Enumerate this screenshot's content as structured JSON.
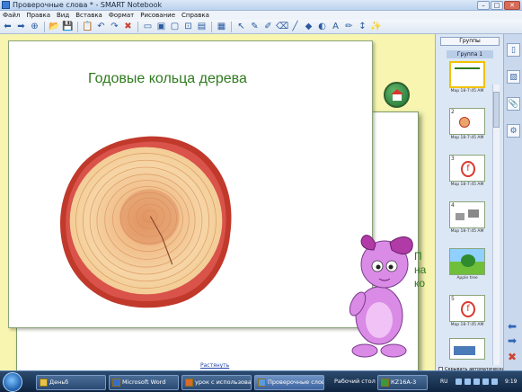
{
  "window": {
    "title": "Проверочные слова * - SMART Notebook",
    "buttons": [
      "–",
      "□",
      "✕"
    ]
  },
  "menu": [
    "Файл",
    "Правка",
    "Вид",
    "Вставка",
    "Формат",
    "Рисование",
    "Справка"
  ],
  "toolbar": {
    "icons": [
      "back-icon",
      "forward-icon",
      "add-page-icon",
      "sep",
      "open-icon",
      "save-icon",
      "sep",
      "paste-icon",
      "undo-icon",
      "redo-icon",
      "delete-icon",
      "sep",
      "screen-shade-icon",
      "display-icon",
      "fullscreen-icon",
      "capture-icon",
      "record-icon",
      "sep",
      "table-icon",
      "sep",
      "select-icon",
      "pen-icon",
      "creative-pen-icon",
      "eraser-icon",
      "line-icon",
      "shape-icon",
      "fill-icon",
      "text-icon",
      "properties-icon",
      "move-toolbar-icon",
      "magic-pen-icon"
    ]
  },
  "slide": {
    "title": "Годовые кольца дерева",
    "partial_text": [
      "П",
      "на",
      "ко"
    ],
    "expand_link": "Растянуть"
  },
  "panel": {
    "groups_button": "Группы",
    "group_label": "Группа 1",
    "thumbnails": [
      {
        "num": "",
        "caption": "Мар 18-7:45 AM",
        "selected": true
      },
      {
        "num": "2",
        "caption": "Мар 18-7:45 AM",
        "selected": false
      },
      {
        "num": "3",
        "caption": "Мар 18-7:45 AM",
        "selected": false
      },
      {
        "num": "4",
        "caption": "Мар 18-7:45 AM",
        "selected": false
      },
      {
        "num": "",
        "caption": "Apple tree",
        "selected": false
      },
      {
        "num": "5",
        "caption": "Мар 18-7:45 AM",
        "selected": false
      },
      {
        "num": "",
        "caption": "",
        "selected": false
      }
    ],
    "autohide_label": "Скрывать автоматически"
  },
  "taskbar": {
    "tasks": [
      "Деньб",
      "Microsoft Word",
      "урок с использова...",
      "Проверочные слова...",
      "Рабочий стол",
      "КZ16А-3"
    ],
    "lang": "RU",
    "clock": "9:19"
  },
  "colors": {
    "title_green": "#2f7a1e",
    "workspace": "#f7f5b0",
    "stump_bark": "#c0392b",
    "stump_wood": "#f2c78a"
  }
}
